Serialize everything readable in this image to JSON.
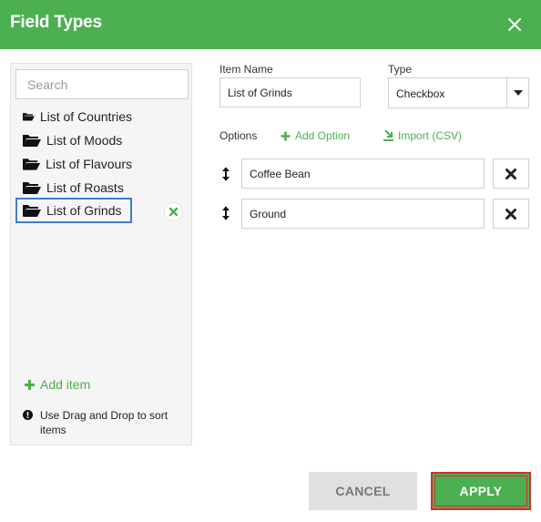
{
  "dialog": {
    "title": "Field Types",
    "close_icon": "close-icon"
  },
  "sidebar": {
    "search_placeholder": "Search",
    "items": [
      {
        "label": "List of Countries",
        "icon": "folder-open-icon"
      },
      {
        "label": "List of Moods",
        "icon": "folder-open-icon"
      },
      {
        "label": "List of Flavours",
        "icon": "folder-open-icon"
      },
      {
        "label": "List of Roasts",
        "icon": "folder-open-icon"
      },
      {
        "label": "List of Grinds",
        "icon": "folder-open-icon",
        "selected": true
      }
    ],
    "add_item_label": "Add item",
    "hint_text": "Use Drag and Drop to sort items"
  },
  "form": {
    "item_name_label": "Item Name",
    "item_name_value": "List of Grinds",
    "type_label": "Type",
    "type_value": "Checkbox",
    "options_label": "Options",
    "add_option_label": "Add Option",
    "import_label": "Import (CSV)",
    "options": [
      {
        "value": "Coffee Bean"
      },
      {
        "value": "Ground"
      }
    ]
  },
  "footer": {
    "cancel_label": "CANCEL",
    "apply_label": "APPLY"
  },
  "colors": {
    "brand_green": "#4caf50",
    "selection_blue": "#3f7dc8",
    "highlight_red": "#d32f2f"
  }
}
